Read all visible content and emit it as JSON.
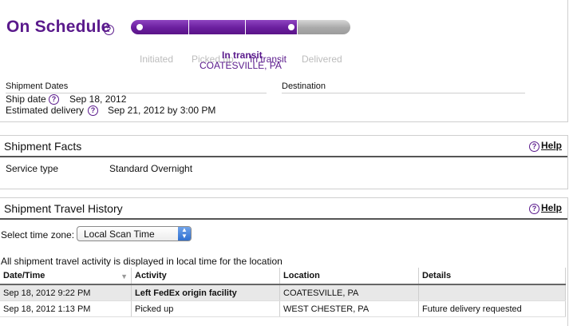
{
  "status": {
    "title": "On Schedule",
    "stages": [
      "Initiated",
      "Picked up",
      "In transit",
      "Delivered"
    ],
    "current_stage_index": 2,
    "current_status": "In transit",
    "current_location": "COATESVILLE, PA"
  },
  "shipment_dates": {
    "heading": "Shipment Dates",
    "ship_date_label": "Ship date",
    "ship_date": "Sep 18, 2012",
    "estimated_label": "Estimated delivery",
    "estimated_delivery": "Sep 21, 2012 by 3:00 PM"
  },
  "destination": {
    "heading": "Destination"
  },
  "facts": {
    "title": "Shipment Facts",
    "help": "Help",
    "service_label": "Service type",
    "service_value": "Standard Overnight"
  },
  "history": {
    "title": "Shipment Travel History",
    "help": "Help",
    "tz_label": "Select time zone:",
    "tz_value": "Local Scan Time",
    "note": "All shipment travel activity is displayed in local time for the location",
    "columns": [
      "Date/Time",
      "Activity",
      "Location",
      "Details"
    ],
    "rows": [
      {
        "datetime": "Sep 18, 2012 9:22 PM",
        "activity": "Left FedEx origin facility",
        "location": "COATESVILLE, PA",
        "details": ""
      },
      {
        "datetime": "Sep 18, 2012 1:13 PM",
        "activity": "Picked up",
        "location": "WEST CHESTER, PA",
        "details": "Future delivery requested"
      }
    ]
  },
  "colors": {
    "brand_purple": "#5a1a8c",
    "inactive_grey": "#bcbcbc"
  },
  "icons": {
    "help": "question-circle-icon",
    "select_arrows": "updown-arrows-icon",
    "sort": "sort-down-icon"
  }
}
